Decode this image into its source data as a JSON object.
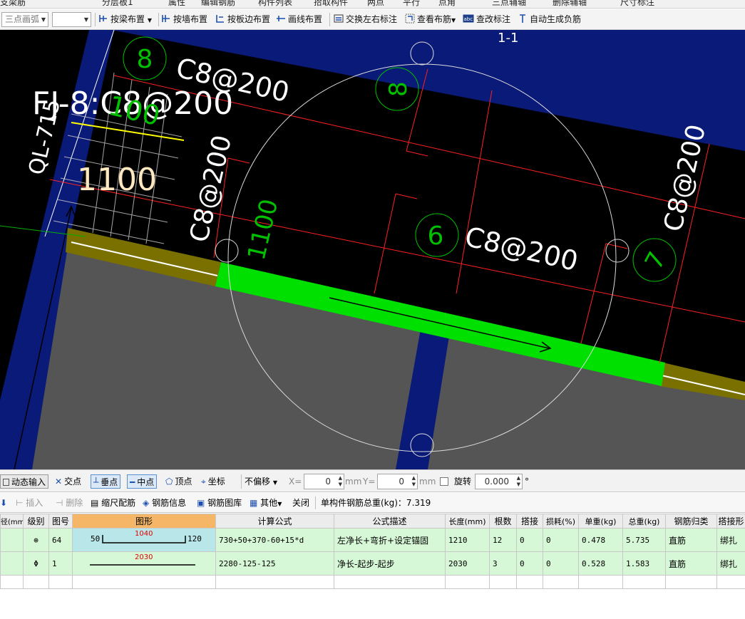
{
  "top_strip": {
    "left_text": "支梁筋",
    "mid_text": "分层板1",
    "items": [
      "属性",
      "编辑钢筋",
      "构件列表",
      "拾取构件",
      "两点",
      "平行",
      "点角",
      "三点辅轴",
      "删除辅轴",
      "尺寸标注"
    ]
  },
  "toolbar": {
    "arc_combo": "三点画弧",
    "blank_combo": "",
    "beam_layout": "按梁布置",
    "wall_layout": "按墙布置",
    "slab_edge_layout": "按板边布置",
    "line_layout": "画线布置",
    "swap_label": "交换左右标注",
    "view_rebar": "查看布筋",
    "edit_label": "查改标注",
    "auto_neg": "自动生成负筋"
  },
  "canvas": {
    "labels": {
      "c8_top": "C8@200",
      "fj_label": "FJ-8:C8@200",
      "dim_100": "100",
      "dim_1100_white": "1100",
      "c8_vert_left": "C8@200",
      "dim_1100_green": "1100",
      "c8_mid": "C8@200",
      "c8_vert_right": "C8@200",
      "circ_8a": "8",
      "circ_8b": "8",
      "circ_6": "6",
      "circ_7": "7",
      "section_1_1": "1-1",
      "side_label": "QL-715"
    },
    "colors": {
      "blue_beam": "#0a1a78",
      "green_rebar": "#00e000",
      "olive_band": "#7a7000",
      "gray_slab": "#555555",
      "red_line": "#ff2020"
    }
  },
  "statusbar": {
    "dynamic_input": "动态输入",
    "intersect": "交点",
    "perp": "垂点",
    "midpoint": "中点",
    "vertex": "顶点",
    "coord": "坐标",
    "offset_combo": "不偏移",
    "x_label": "X=",
    "x_value": "0",
    "unit1": "mm",
    "y_label": "Y=",
    "y_value": "0",
    "unit2": "mm",
    "rotate_label": "旋转",
    "rotate_value": "0.000",
    "degree": "°"
  },
  "rebarbar": {
    "insert": "插入",
    "delete": "删除",
    "scale": "缩尺配筋",
    "info": "钢筋信息",
    "library": "钢筋图库",
    "other": "其他",
    "close": "关闭",
    "total": "单构件钢筋总重(kg)：7.319"
  },
  "table": {
    "headers": [
      "径(mm)",
      "级别",
      "图号",
      "图形",
      "计算公式",
      "公式描述",
      "长度(mm)",
      "根数",
      "搭接",
      "损耗(%)",
      "单重(kg)",
      "总重(kg)",
      "钢筋归类",
      "搭接形"
    ],
    "rows": [
      {
        "dia": "",
        "grade": "⊕",
        "fig": "64",
        "shape_left": "50",
        "shape_mid": "1040",
        "shape_right": "120",
        "formula": "730+50+370-60+15*d",
        "desc": "左净长+弯折+设定锚固",
        "length": "1210",
        "count": "12",
        "lap": "0",
        "loss": "0",
        "unit_w": "0.478",
        "total_w": "5.735",
        "cat": "直筋",
        "lap_type": "绑扎"
      },
      {
        "dia": "",
        "grade": "Φ",
        "fig": "1",
        "shape_left": "",
        "shape_mid": "2030",
        "shape_right": "",
        "formula": "2280-125-125",
        "desc": "净长-起步-起步",
        "length": "2030",
        "count": "3",
        "lap": "0",
        "loss": "0",
        "unit_w": "0.528",
        "total_w": "1.583",
        "cat": "直筋",
        "lap_type": "绑扎"
      }
    ]
  }
}
